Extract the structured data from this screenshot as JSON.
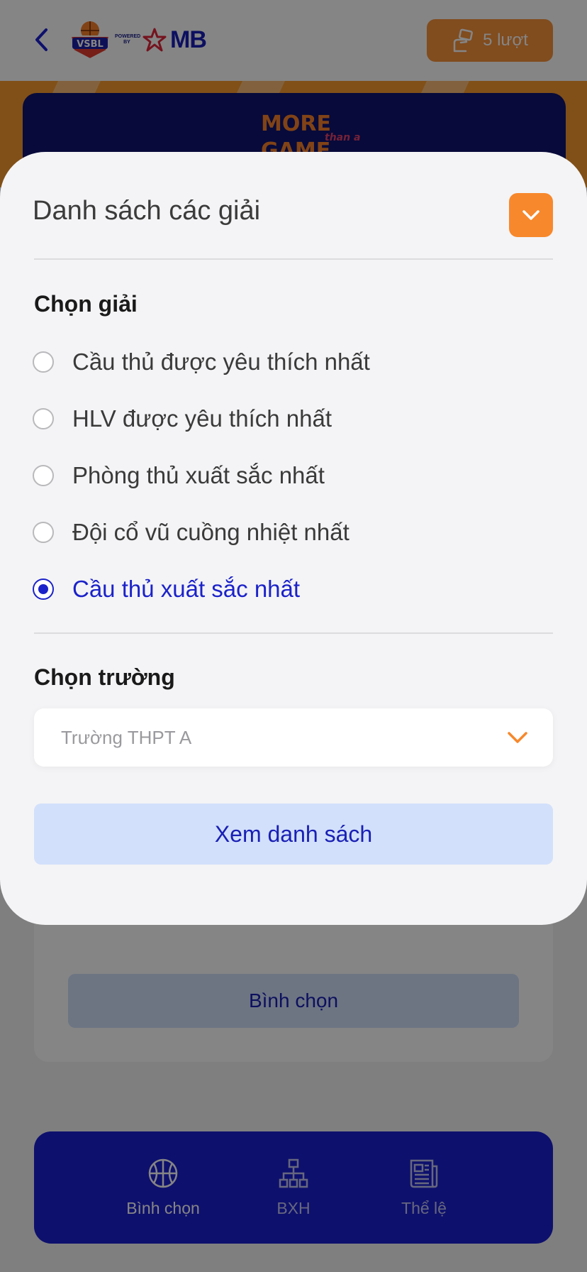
{
  "header": {
    "back_icon": "chevron-left-icon",
    "logo": {
      "badge_text": "VSBL",
      "powered_text": "POWERED BY",
      "brand_text": "MB"
    },
    "votes_label": "5 lượt",
    "votes_icon": "hand-ballot-icon"
  },
  "banner": {
    "title_line1": "MORE",
    "title_script": "than a",
    "title_line2": "GAME"
  },
  "vote_card": {
    "button_label": "Bình chọn"
  },
  "bottom_nav": {
    "items": [
      {
        "label": "Bình chọn",
        "icon": "basketball-icon",
        "active": true
      },
      {
        "label": "BXH",
        "icon": "org-chart-icon",
        "active": false
      },
      {
        "label": "Thể lệ",
        "icon": "newspaper-icon",
        "active": false
      }
    ]
  },
  "sheet": {
    "title": "Danh sách các giải",
    "collapse_icon": "chevron-down-icon",
    "award_section_label": "Chọn giải",
    "awards": [
      {
        "label": "Cầu thủ được yêu thích nhất",
        "selected": false
      },
      {
        "label": "HLV được yêu thích nhất",
        "selected": false
      },
      {
        "label": "Phòng thủ xuất sắc nhất",
        "selected": false
      },
      {
        "label": "Đội cổ vũ cuồng nhiệt nhất",
        "selected": false
      },
      {
        "label": "Cầu thủ xuất sắc nhất",
        "selected": true
      }
    ],
    "school_section_label": "Chọn trường",
    "school_select": {
      "value": "Trường THPT A",
      "icon": "chevron-down-icon"
    },
    "view_list_button": "Xem danh sách"
  },
  "colors": {
    "brand_blue": "#1b1fd1",
    "accent_orange": "#f7882c",
    "selected_text": "#1b22c9",
    "button_bg": "#d2e0fb"
  }
}
